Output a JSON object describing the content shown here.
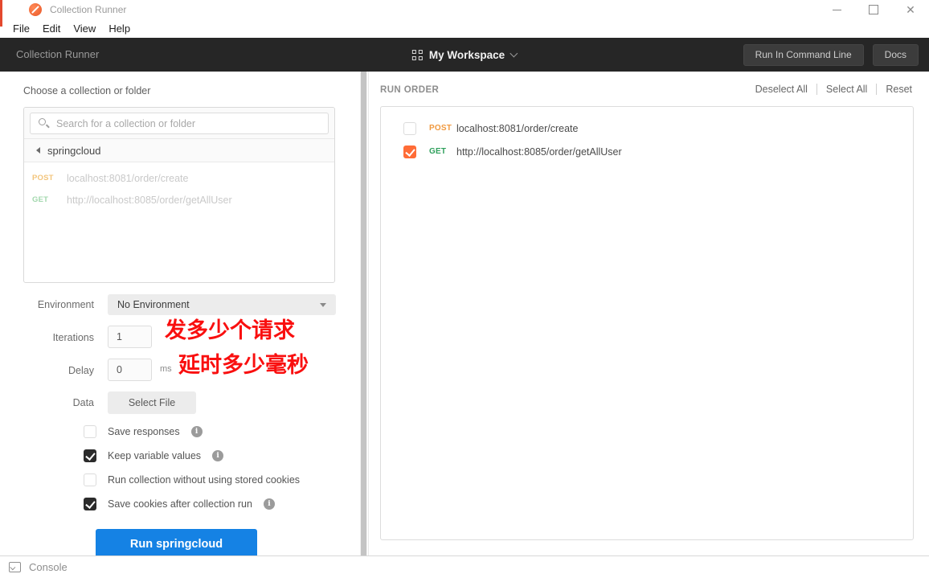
{
  "window": {
    "title": "Collection Runner",
    "menu": [
      "File",
      "Edit",
      "View",
      "Help"
    ]
  },
  "header": {
    "title": "Collection Runner",
    "workspace": "My Workspace",
    "run_cli_button": "Run In Command Line",
    "docs_button": "Docs"
  },
  "left": {
    "choose_label": "Choose a collection or folder",
    "search_placeholder": "Search for a collection or folder",
    "collection_name": "springcloud",
    "requests": [
      {
        "method": "POST",
        "url": "localhost:8081/order/create"
      },
      {
        "method": "GET",
        "url": "http://localhost:8085/order/getAllUser"
      }
    ],
    "form": {
      "environment_label": "Environment",
      "environment_value": "No Environment",
      "iterations_label": "Iterations",
      "iterations_value": "1",
      "delay_label": "Delay",
      "delay_value": "0",
      "delay_unit": "ms",
      "data_label": "Data",
      "select_file_button": "Select File",
      "checkboxes": [
        {
          "label": "Save responses",
          "checked": false
        },
        {
          "label": "Keep variable values",
          "checked": true
        },
        {
          "label": "Run collection without using stored cookies",
          "checked": false
        },
        {
          "label": "Save cookies after collection run",
          "checked": true
        }
      ],
      "run_button": "Run springcloud"
    },
    "annotations": {
      "iterations_note": "发多少个请求",
      "delay_note": "延时多少毫秒"
    }
  },
  "right": {
    "title": "RUN ORDER",
    "actions": {
      "deselect_all": "Deselect All",
      "select_all": "Select All",
      "reset": "Reset"
    },
    "rows": [
      {
        "checked": false,
        "method": "POST",
        "url": "localhost:8081/order/create"
      },
      {
        "checked": true,
        "method": "GET",
        "url": "http://localhost:8085/order/getAllUser"
      }
    ]
  },
  "footer": {
    "console_label": "Console"
  },
  "colors": {
    "accent_orange": "#ff6c37",
    "post_method": "#f0993f",
    "get_method": "#2fa05c",
    "run_button_blue": "#1582e4",
    "annotation_red": "#f90f0f",
    "header_dark": "#262626"
  }
}
